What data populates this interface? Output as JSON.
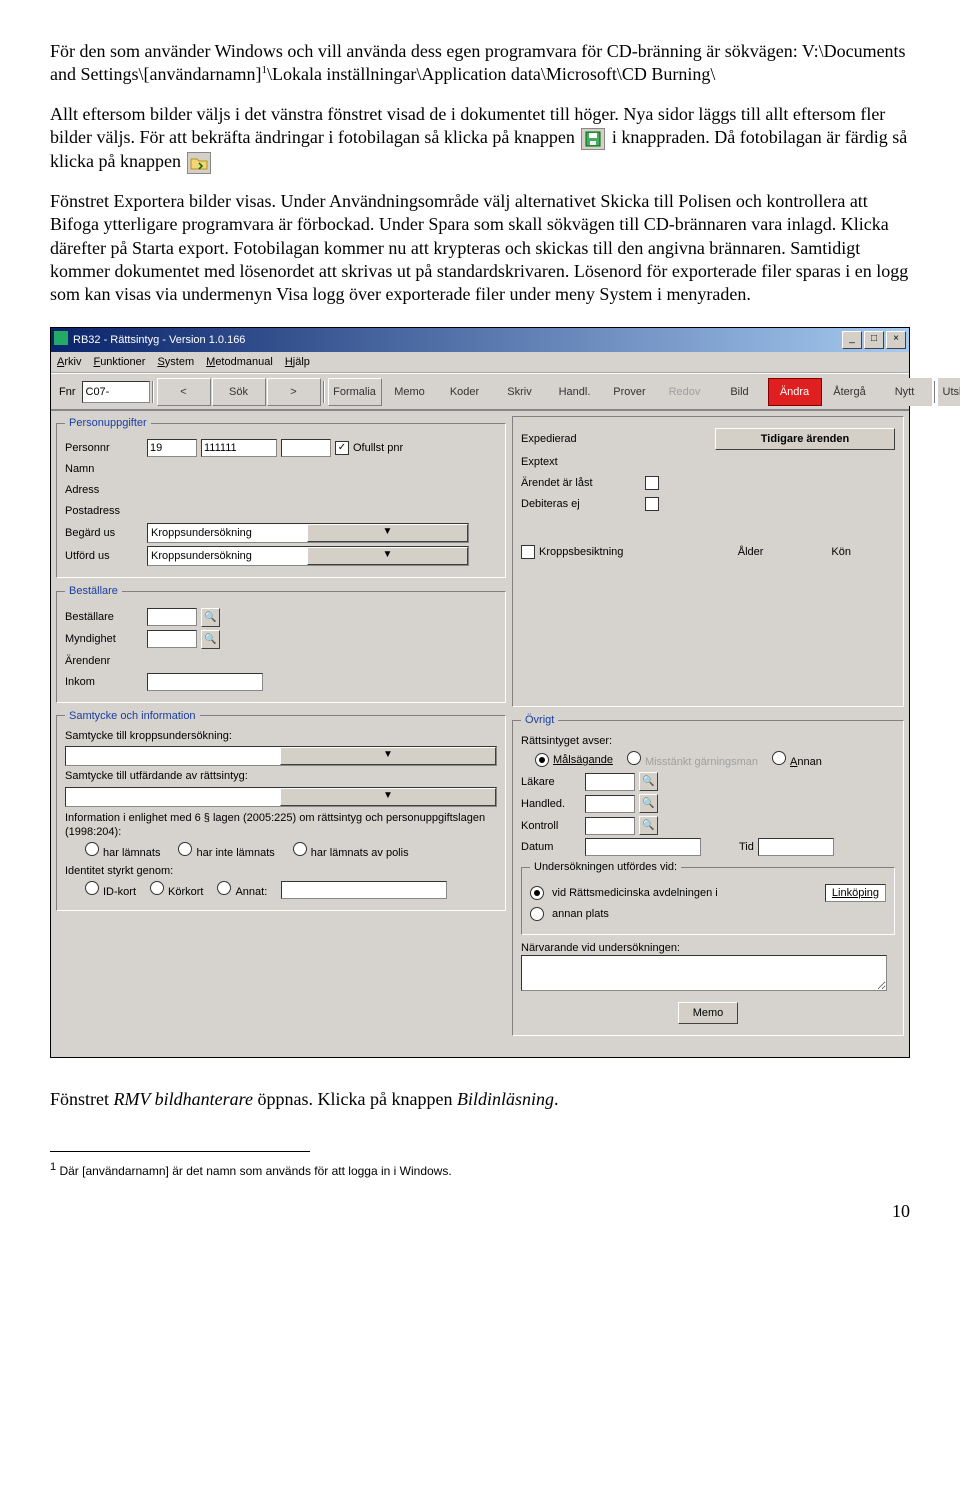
{
  "para1_a": "För den som använder Windows och vill använda dess egen programvara för CD-bränning är sökvägen: V:\\Documents and Settings\\[användarnamn]",
  "para1_b": "\\Lokala inställningar\\Application data\\Microsoft\\CD Burning\\",
  "sup1": "1",
  "para2_a": "Allt eftersom bilder väljs i det vänstra fönstret visad de i dokumentet till höger. Nya sidor läggs till allt eftersom fler bilder väljs. För att bekräfta ändringar i fotobilagan så klicka på knappen",
  "para2_b": "i knappraden. Då fotobilagan är färdig så klicka på knappen",
  "para3": "Fönstret Exportera bilder visas. Under Användningsområde välj alternativet Skicka till Polisen och kontrollera att Bifoga ytterligare programvara är förbockad. Under Spara som skall sökvägen till CD-brännaren vara inlagd. Klicka därefter på Starta export. Fotobilagan kommer nu att krypteras och skickas till den angivna brännaren. Samtidigt kommer dokumentet med lösenordet att skrivas ut på standardskrivaren. Lösenord för exporterade filer sparas i en logg som kan visas via undermenyn Visa logg över exporterade filer under meny System i menyraden.",
  "after_ss": "Fönstret RMV bildhanterare öppnas. Klicka på knappen Bildinläsning.",
  "footnote": "Där [användarnamn] är det namn som används för att logga in i Windows.",
  "footnote_num": "1",
  "pagenum": "10",
  "win": {
    "title": "RB32 - Rättsintyg - Version 1.0.166",
    "menu": [
      "Arkiv",
      "Funktioner",
      "System",
      "Metodmanual",
      "Hjälp"
    ],
    "fnr_label": "Fnr",
    "fnr_value": "C07-",
    "toolbar": {
      "prev": "<",
      "sok": "Sök",
      "next": ">",
      "items": [
        "Formalia",
        "Memo",
        "Koder",
        "Skriv",
        "Handl.",
        "Prover",
        "Redov",
        "Bild",
        "Ändra",
        "Återgå",
        "Nytt",
        "Utskrifter"
      ]
    },
    "groups": {
      "person": "Personuppgifter",
      "best": "Beställare",
      "samtycke": "Samtycke och information",
      "ovrigt": "Övrigt"
    },
    "labels": {
      "personnr": "Personnr",
      "namn": "Namn",
      "adress": "Adress",
      "postadress": "Postadress",
      "begard": "Begärd us",
      "utford": "Utförd us",
      "ofullst": "Ofullst pnr",
      "expedierad": "Expedierad",
      "exptext": "Exptext",
      "last": "Ärendet är låst",
      "debiteras": "Debiteras ej",
      "kropps": "Kroppsbesiktning",
      "alder": "Ålder",
      "kon": "Kön",
      "tidigare": "Tidigare ärenden",
      "bestallare": "Beställare",
      "myndighet": "Myndighet",
      "arendenr": "Ärendenr",
      "inkom": "Inkom",
      "samtycke_kropp": "Samtycke till kroppsundersökning:",
      "samtycke_ratt": "Samtycke till utfärdande av rättsintyg:",
      "info_law": "Information i enlighet med 6 § lagen (2005:225) om rättsintyg och personuppgiftslagen (1998:204):",
      "har_lamnats": "har lämnats",
      "har_inte": "har inte lämnats",
      "av_polis": "har lämnats av polis",
      "identitet": "Identitet styrkt genom:",
      "idkort": "ID-kort",
      "korkort": "Körkort",
      "annat": "Annat:",
      "avser": "Rättsintyget avser:",
      "mals": "Målsägande",
      "misst": "Misstänkt gärningsman",
      "annan": "Annan",
      "lakare": "Läkare",
      "handled": "Handled.",
      "kontroll": "Kontroll",
      "datum": "Datum",
      "tid": "Tid",
      "utfordes": "Undersökningen utfördes vid:",
      "vid_ratts": "vid Rättsmedicinska avdelningen i",
      "linkoping": "Linköping",
      "annan_plats": "annan plats",
      "narvarande": "Närvarande vid undersökningen:",
      "memo": "Memo"
    },
    "values": {
      "pnr1": "19",
      "pnr2": "111111",
      "kropps_drop": "Kroppsundersökning"
    }
  }
}
